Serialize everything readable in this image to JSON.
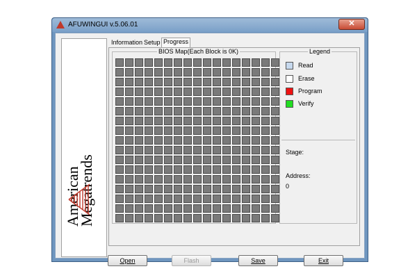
{
  "window": {
    "title": "AFUWINGUI v.5.06.01",
    "close_glyph": "✕"
  },
  "logo": {
    "line1": "American",
    "line2": "Megatrends"
  },
  "tabs": [
    {
      "label": "Information",
      "active": false
    },
    {
      "label": "Setup",
      "active": false
    },
    {
      "label": "Progress",
      "active": true
    }
  ],
  "bios_map": {
    "label": "BIOS Map(Each Block is 0K)",
    "columns": 17,
    "rows": 17
  },
  "legend": {
    "label": "Legend",
    "items": [
      {
        "label": "Read",
        "color": "#c7d9ee"
      },
      {
        "label": "Erase",
        "color": "#ffffff"
      },
      {
        "label": "Program",
        "color": "#ee1111"
      },
      {
        "label": "Verify",
        "color": "#22dd22"
      }
    ]
  },
  "status": {
    "stage_label": "Stage:",
    "stage_value": "",
    "address_label": "Address:",
    "address_value": "0"
  },
  "buttons": {
    "open": "Open",
    "flash": "Flash",
    "save": "Save",
    "exit": "Exit"
  },
  "colors": {
    "block_fill": "#7a7a7a",
    "brand_red": "#c0392b"
  }
}
